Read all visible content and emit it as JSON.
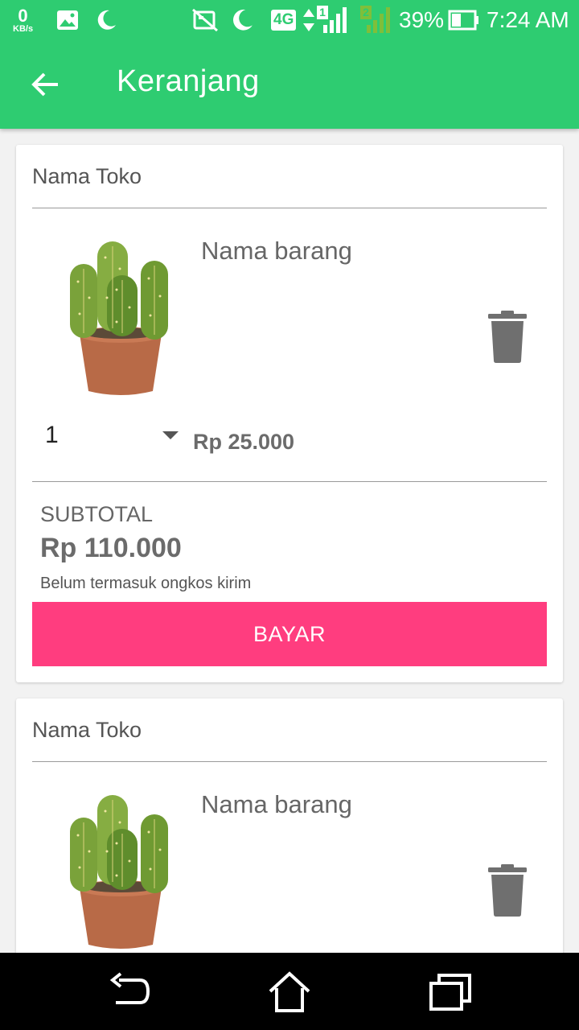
{
  "status_bar": {
    "net_speed_value": "0",
    "net_speed_unit": "KB/s",
    "network_type": "4G",
    "sim1_label": "1",
    "sim2_label": "2",
    "battery": "39%",
    "time": "7:24 AM",
    "icons": [
      "image-icon",
      "moon-icon",
      "no-sim-icon",
      "moon-icon",
      "data-arrows-icon",
      "signal-icon",
      "battery-icon"
    ]
  },
  "toolbar": {
    "back_icon": "arrow-left-icon",
    "title": "Keranjang"
  },
  "carts": [
    {
      "store_name": "Nama Toko",
      "item": {
        "name": "Nama barang",
        "quantity": "1",
        "price": "Rp 25.000",
        "image": "cactus-in-pot"
      },
      "subtotal_label": "SUBTOTAL",
      "subtotal_value": "Rp 110.000",
      "shipping_note": "Belum termasuk ongkos kirim",
      "pay_label": "BAYAR"
    },
    {
      "store_name": "Nama Toko",
      "item": {
        "name": "Nama barang",
        "image": "cactus-in-pot"
      }
    }
  ],
  "nav_bar": {
    "buttons": [
      "back-icon",
      "home-icon",
      "recent-apps-icon"
    ]
  },
  "colors": {
    "app_bar": "#2ecc71",
    "pay_button": "#ff3d7f",
    "text_muted": "#666666",
    "trash_icon": "#6f6f6f"
  }
}
